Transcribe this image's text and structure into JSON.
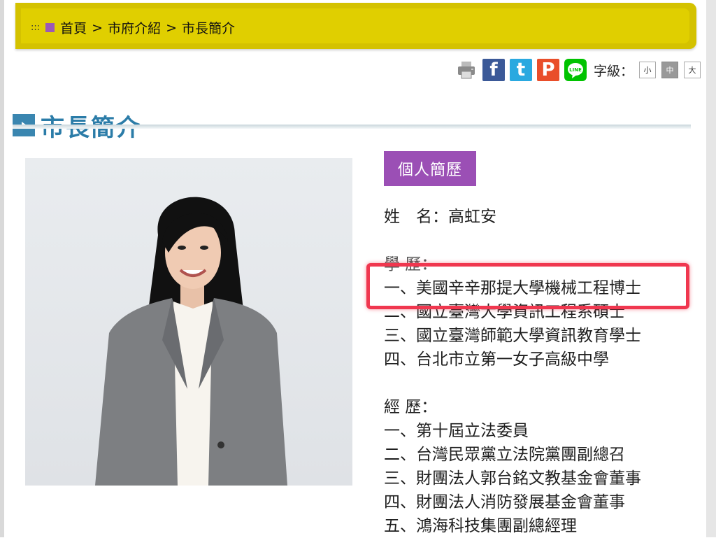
{
  "breadcrumb": {
    "dots": ":::",
    "items": [
      "首頁",
      "市府介紹",
      "市長簡介"
    ],
    "separator": ">"
  },
  "toolbar": {
    "share_icons": [
      "print-icon",
      "facebook-icon",
      "twitter-icon",
      "plurk-icon",
      "line-icon"
    ],
    "font_size_label": "字級：",
    "font_sizes": [
      "小",
      "中",
      "大"
    ],
    "active_font_size": "中"
  },
  "page": {
    "title": "市長簡介"
  },
  "profile": {
    "section_button": "個人簡歷",
    "name_row": "姓　名：高虹安",
    "education_heading": "學 歷：",
    "education": [
      "一、美國辛辛那提大學機械工程博士",
      "二、國立臺灣大學資訊工程系碩士",
      "三、國立臺灣師範大學資訊教育學士",
      "四、台北市立第一女子高級中學"
    ],
    "experience_heading": "經 歷：",
    "experience": [
      "一、第十屆立法委員",
      "二、台灣民眾黨立法院黨團副總召",
      "三、財團法人郭台銘文教基金會董事",
      "四、財團法人消防發展基金會董事",
      "五、鴻海科技集團副總經理"
    ]
  },
  "colors": {
    "breadcrumb_bar": "#e0cf00",
    "title_blue": "#2b7ca8",
    "section_purple": "#9b4fb5",
    "highlight_red": "#f0374f"
  }
}
